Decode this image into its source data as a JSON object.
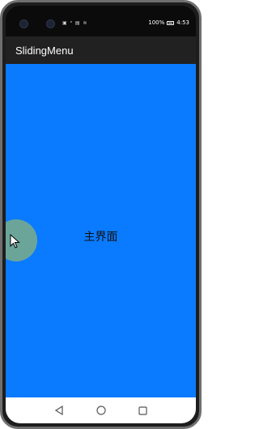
{
  "statusbar": {
    "battery_text": "100%",
    "time": "4:53",
    "left_icons": "▣ ᵃ ▤ ≋"
  },
  "appbar": {
    "title": "SlidingMenu"
  },
  "main": {
    "label": "主界面"
  },
  "navbar": {
    "back_icon": "triangle-back-icon",
    "home_icon": "circle-home-icon",
    "recents_icon": "square-recents-icon"
  },
  "colors": {
    "content_bg": "#0a7aff",
    "appbar_bg": "#212121"
  }
}
